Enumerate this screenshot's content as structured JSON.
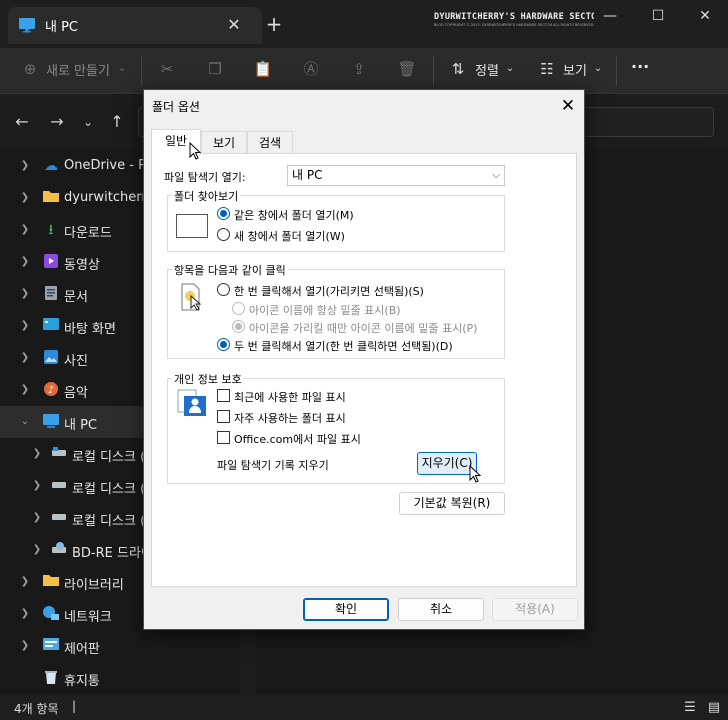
{
  "window": {
    "tab_title": "내 PC",
    "tab_close": "✕",
    "new_tab": "+",
    "watermark_title": "DYURWITCHERRY'S HARDWARE SECTOR",
    "watermark_sub": "BLOG COPYRIGHT © 2015. DYURWITCHERRY'S HARDWARE SECTOR ALL RIGHTS RESERVED.",
    "minimize": "—",
    "maximize": "☐",
    "close": "✕"
  },
  "toolbar": {
    "new_label": "새로 만들기",
    "sort_label": "정렬",
    "view_label": "보기",
    "more_label": "···"
  },
  "sidebar": {
    "items": [
      {
        "label": "OneDrive - Per"
      },
      {
        "label": "dyurwitcherry"
      },
      {
        "label": "다운로드"
      },
      {
        "label": "동영상"
      },
      {
        "label": "문서"
      },
      {
        "label": "바탕 화면"
      },
      {
        "label": "사진"
      },
      {
        "label": "음악"
      },
      {
        "label": "내 PC"
      },
      {
        "label": "로컬 디스크 ("
      },
      {
        "label": "로컬 디스크 ("
      },
      {
        "label": "로컬 디스크 ("
      },
      {
        "label": "BD-RE 드라이"
      },
      {
        "label": "라이브러리"
      },
      {
        "label": "네트워크"
      },
      {
        "label": "제어판"
      },
      {
        "label": "휴지통"
      }
    ]
  },
  "status": {
    "count": "4개 항목",
    "separator": "|"
  },
  "dialog": {
    "title": "폴더 옵션",
    "close": "✕",
    "tabs": [
      "일반",
      "보기",
      "검색"
    ],
    "open_label": "파일 탐색기 열기:",
    "open_value": "내 PC",
    "browse_group": "폴더 찾아보기",
    "browse_same": "같은 창에서 폴더 열기(M)",
    "browse_new": "새 창에서 폴더 열기(W)",
    "click_group": "항목을 다음과 같이 클릭",
    "single_click": "한 번 클릭해서 열기(가리키면 선택됨)(S)",
    "underline_always": "아이콘 이름에 항상 밑줄 표시(B)",
    "underline_hover": "아이콘을 가리킬 때만 아이콘 이름에 밑줄 표시(P)",
    "double_click": "두 번 클릭해서 열기(한 번 클릭하면 선택됨)(D)",
    "privacy_group": "개인 정보 보호",
    "recent_files": "최근에 사용한 파일 표시",
    "frequent_folders": "자주 사용하는 폴더 표시",
    "office_files": "Office.com에서 파일 표시",
    "clear_history_label": "파일 탐색기 기록 지우기",
    "clear_button": "지우기(C)",
    "restore_button": "기본값 복원(R)",
    "ok_button": "확인",
    "cancel_button": "취소",
    "apply_button": "적용(A)"
  }
}
